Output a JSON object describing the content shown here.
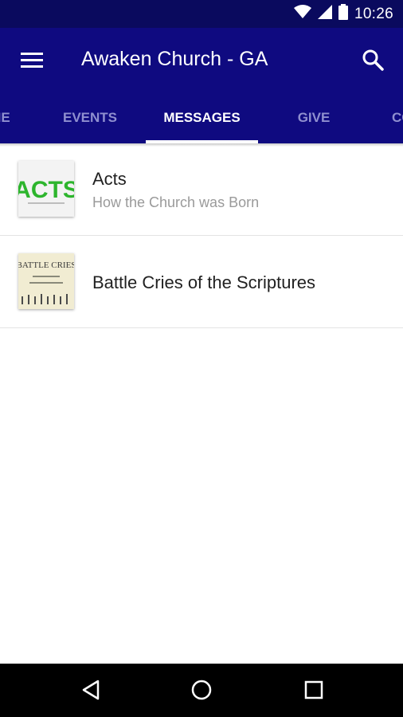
{
  "status": {
    "time": "10:26"
  },
  "appbar": {
    "title": "Awaken Church - GA"
  },
  "tabs": [
    {
      "label": "ME"
    },
    {
      "label": "EVENTS"
    },
    {
      "label": "MESSAGES"
    },
    {
      "label": "GIVE"
    },
    {
      "label": "CO"
    }
  ],
  "messages": [
    {
      "title": "Acts",
      "subtitle": "How the Church was Born",
      "thumb_text": "ACTS"
    },
    {
      "title": "Battle Cries of the Scriptures",
      "thumb_text": "BATTLE CRIES"
    }
  ],
  "colors": {
    "appbar": "#0f0a80",
    "statusbar": "#0a0a5e",
    "active_tab": "#ffffff",
    "inactive_tab": "#8f8fcf"
  },
  "icons": [
    "menu-icon",
    "search-icon",
    "wifi-icon",
    "signal-icon",
    "battery-icon",
    "back-icon",
    "home-icon",
    "recents-icon"
  ]
}
